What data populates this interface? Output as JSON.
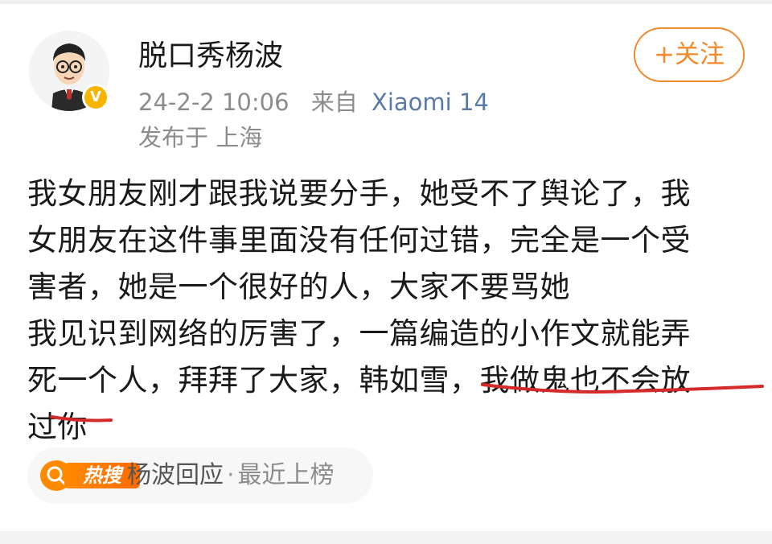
{
  "post": {
    "author": {
      "name": "脱口秀杨波",
      "verified_mark": "V"
    },
    "timestamp": "24-2-2 10:06",
    "source_prefix": "来自",
    "device": "Xiaomi 14",
    "location": "发布于 上海",
    "follow_label": "+关注",
    "content_lines": [
      "我女朋友刚才跟我说要分手，她受不了舆论了，我",
      "女朋友在这件事里面没有任何过错，完全是一个受",
      "害者，她是一个很好的人，大家不要骂她",
      "我见识到网络的厉害了，一篇编造的小作文就能弄",
      "死一个人，拜拜了大家，韩如雪，我做鬼也不会放",
      "过你"
    ],
    "annotation_color": "#d42a2a",
    "hot_search": {
      "badge": "热搜",
      "topic": "杨波回应",
      "separator": "·",
      "tag": "最近上榜"
    }
  },
  "colors": {
    "accent": "#f08a2a",
    "device_link": "#5a7aa8",
    "hot_badge": "#ff8a00",
    "verified": "#f7b500"
  },
  "icons": {
    "avatar": "cartoon-man-avatar",
    "verified": "verified-badge-icon",
    "hot_search": "search-icon"
  }
}
